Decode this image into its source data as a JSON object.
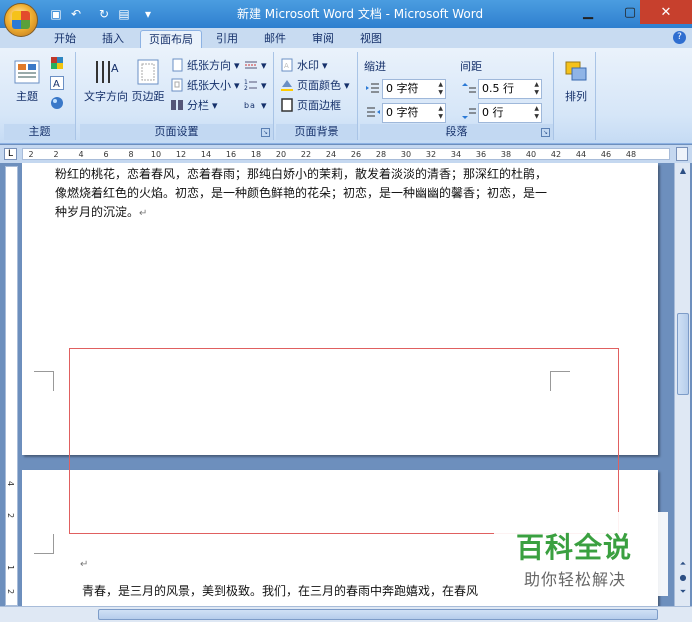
{
  "window": {
    "title": "新建 Microsoft Word 文档 - Microsoft Word",
    "min_icon": "minimize-icon",
    "max_icon": "maximize-icon",
    "close_icon": "close-icon",
    "close_glyph": "✕",
    "min_glyph": "▁",
    "max_glyph": "▢"
  },
  "quick_access": {
    "save_icon": "save-icon",
    "undo_icon": "undo-icon",
    "redo_icon": "redo-icon",
    "print_icon": "print-preview-icon",
    "save_glyph": "▣",
    "undo_glyph": "↶",
    "redo_glyph": "↻",
    "print_glyph": "▤",
    "customize_glyph": "▾"
  },
  "tabs": [
    {
      "label": "开始"
    },
    {
      "label": "插入"
    },
    {
      "label": "页面布局",
      "active": true
    },
    {
      "label": "引用"
    },
    {
      "label": "邮件"
    },
    {
      "label": "审阅"
    },
    {
      "label": "视图"
    }
  ],
  "help_glyph": "?",
  "ribbon": {
    "theme_group": {
      "label": "主题",
      "themes_button": "主题"
    },
    "page_setup_group": {
      "label": "页面设置",
      "text_direction": "文字方向",
      "margins": "页边距",
      "orientation": "纸张方向",
      "size": "纸张大小",
      "columns": "分栏"
    },
    "page_background_group": {
      "label": "页面背景",
      "watermark": "水印",
      "page_color": "页面颜色",
      "page_borders": "页面边框"
    },
    "paragraph_group": {
      "label": "段落",
      "indent_label": "缩进",
      "spacing_label": "间距",
      "indent_left": "0 字符",
      "indent_right": "0 字符",
      "spacing_before": "0.5 行",
      "spacing_after": "0 行"
    },
    "arrange_group": {
      "arrange": "排列"
    }
  },
  "ruler": {
    "corner_glyph": "L",
    "ticks": [
      "2",
      "2",
      "4",
      "6",
      "8",
      "10",
      "12",
      "14",
      "16",
      "18",
      "20",
      "22",
      "24",
      "26",
      "28",
      "30",
      "32",
      "34",
      "36",
      "38",
      "40",
      "42",
      "44",
      "46",
      "48"
    ]
  },
  "vertical_ruler": {
    "ticks": [
      "4",
      "2",
      "1",
      "2"
    ]
  },
  "document": {
    "page1_text": "粉红的桃花，恋着春风，恋着春雨；那纯白娇小的茉莉，散发着淡淡的清香；那深红的杜鹃，像燃烧着红色的火焰。初恋，是一种颜色鲜艳的花朵；初恋，是一种幽幽的馨香；初恋，是一种岁月的沉淀。",
    "page1_mark": "↵",
    "page2_cursor": "↵",
    "page2_text": "青春，是三月的风景，美到极致。我们，在三月的春雨中奔跑嬉戏，在春风"
  },
  "watermark_overlay": {
    "title": "百科全说",
    "subtitle": "助你轻松解决"
  },
  "colors": {
    "title_bar": "#2f7fcf",
    "ribbon": "#d6e6f8",
    "document_bg": "#6d8fbd",
    "red_box": "#e06060",
    "watermark_green": "#3aa040"
  }
}
